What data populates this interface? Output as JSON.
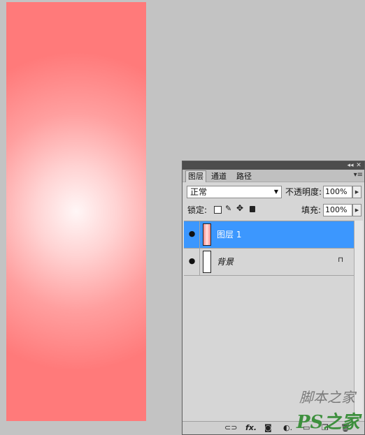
{
  "canvas": {
    "gradient_colors": [
      "#fff6f6",
      "#ffd3d3",
      "#ff9f9f",
      "#ff7a7a"
    ]
  },
  "panel": {
    "collapse_icon": "double-arrow-icon",
    "tabs": [
      {
        "label": "图层",
        "active": true
      },
      {
        "label": "通道",
        "active": false
      },
      {
        "label": "路径",
        "active": false
      }
    ],
    "blend_mode": "正常",
    "opacity_label": "不透明度:",
    "opacity_value": "100%",
    "lock_label": "锁定:",
    "fill_label": "填充:",
    "fill_value": "100%",
    "layers": [
      {
        "name": "图层 1",
        "selected": true,
        "visible": true,
        "thumb_color": "#ffc0c0"
      },
      {
        "name": "背景",
        "selected": false,
        "visible": true,
        "thumb_color": "#ffffff",
        "locked": true
      }
    ],
    "footer_buttons": [
      "link-icon",
      "fx-icon",
      "mask-icon",
      "adjustment-icon",
      "folder-icon",
      "new-layer-icon",
      "trash-icon"
    ],
    "fx_label": "fx."
  },
  "watermark": {
    "line1": "脚本之家",
    "line2": "PS之家"
  },
  "accent_color": "#3c97fe"
}
